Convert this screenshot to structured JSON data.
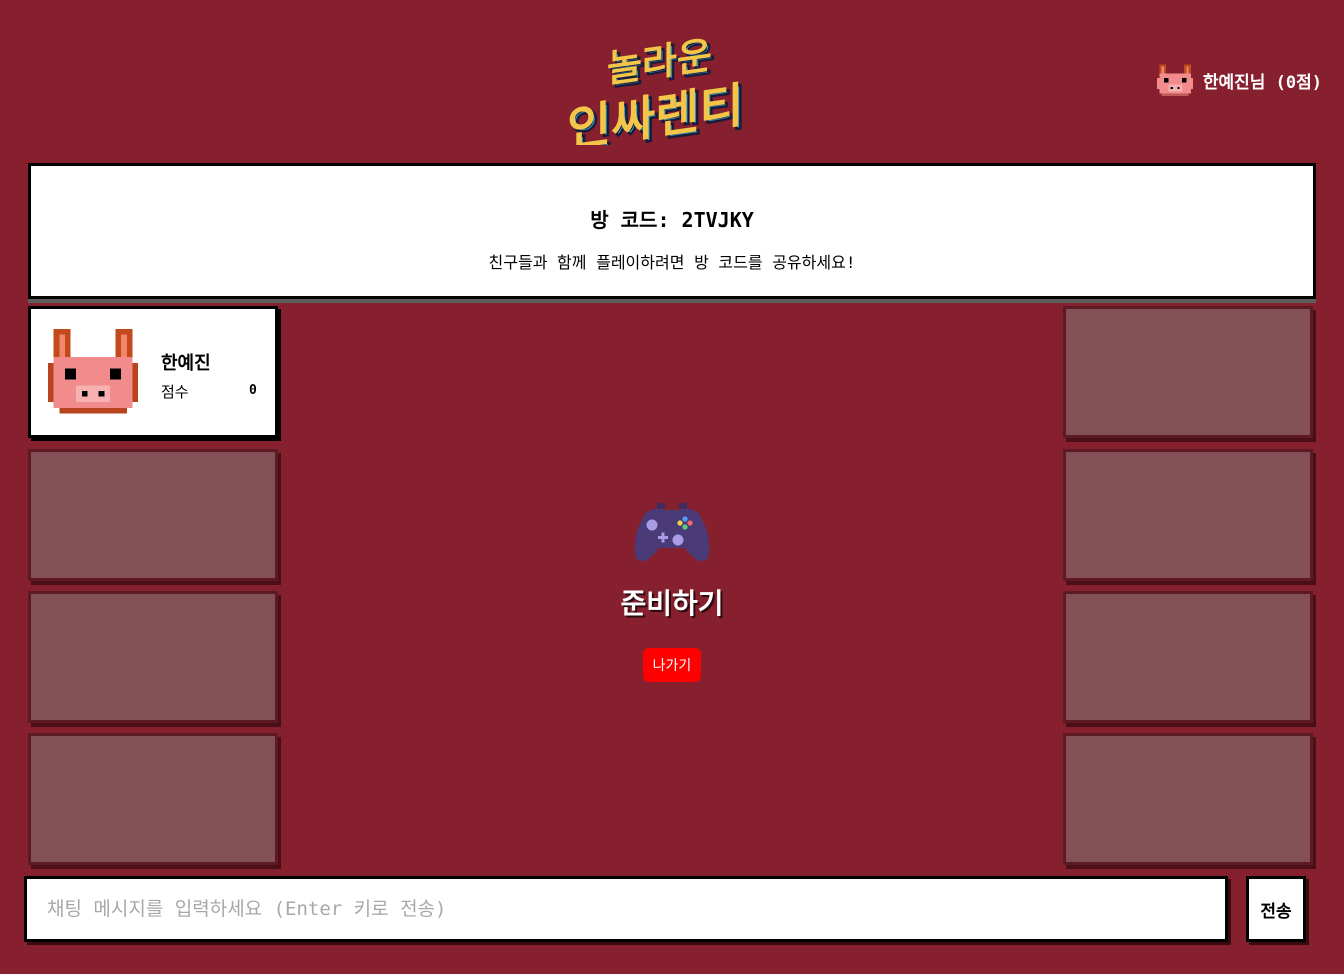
{
  "logo": {
    "line1": "놀라운",
    "line2": "인싸렌티"
  },
  "user": {
    "label": "한예진님 (0점)",
    "avatar_icon": "pig-icon"
  },
  "room": {
    "code_text": "방 코드: 2TVJKY",
    "hint": "친구들과 함께 플레이하려면 방 코드를 공유하세요!"
  },
  "players": [
    {
      "name": "한예진",
      "score_label": "점수",
      "score": "0",
      "avatar_icon": "pig-icon"
    }
  ],
  "center": {
    "icon": "gamepad-icon",
    "title": "준비하기",
    "leave_label": "나가기"
  },
  "chat": {
    "placeholder": "채팅 메시지를 입력하세요 (Enter 키로 전송)",
    "send_label": "전송"
  },
  "colors": {
    "background": "#86202e",
    "empty_slot": "#845058",
    "leave_button": "#ff0000"
  }
}
